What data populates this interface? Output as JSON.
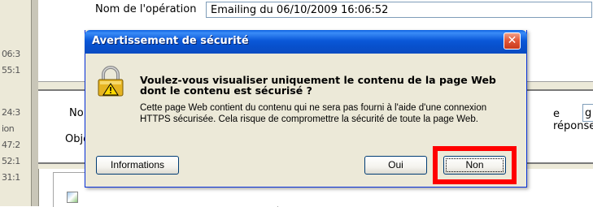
{
  "background": {
    "left_ticks": [
      "06:3",
      "55:1",
      "24:3",
      "ion",
      "47:2",
      "52:1",
      "31:1"
    ],
    "operation_label": "Nom de l'opération",
    "operation_value": "Emailing du 06/10/2009 16:06:52",
    "no_label": "No",
    "obj_label": "Obje",
    "reponse_label": "e réponse",
    "reponse_value": "g"
  },
  "dialog": {
    "title": "Avertissement de sécurité",
    "close_glyph": "✕",
    "question": "Voulez-vous visualiser uniquement le contenu de la page Web dont le contenu est sécurisé ?",
    "explanation": "Cette page Web contient du contenu qui ne sera pas fourni à l'aide d'une connexion HTTPS sécurisée. Cela risque de compromettre la sécurité de toute la page Web.",
    "buttons": {
      "info": "Informations",
      "yes": "Oui",
      "no": "Non"
    },
    "icon": "padlock-warning-icon"
  },
  "colors": {
    "titlebar": "#0a58d8",
    "highlight": "#ff0000",
    "dialog_bg": "#ece9d8"
  }
}
